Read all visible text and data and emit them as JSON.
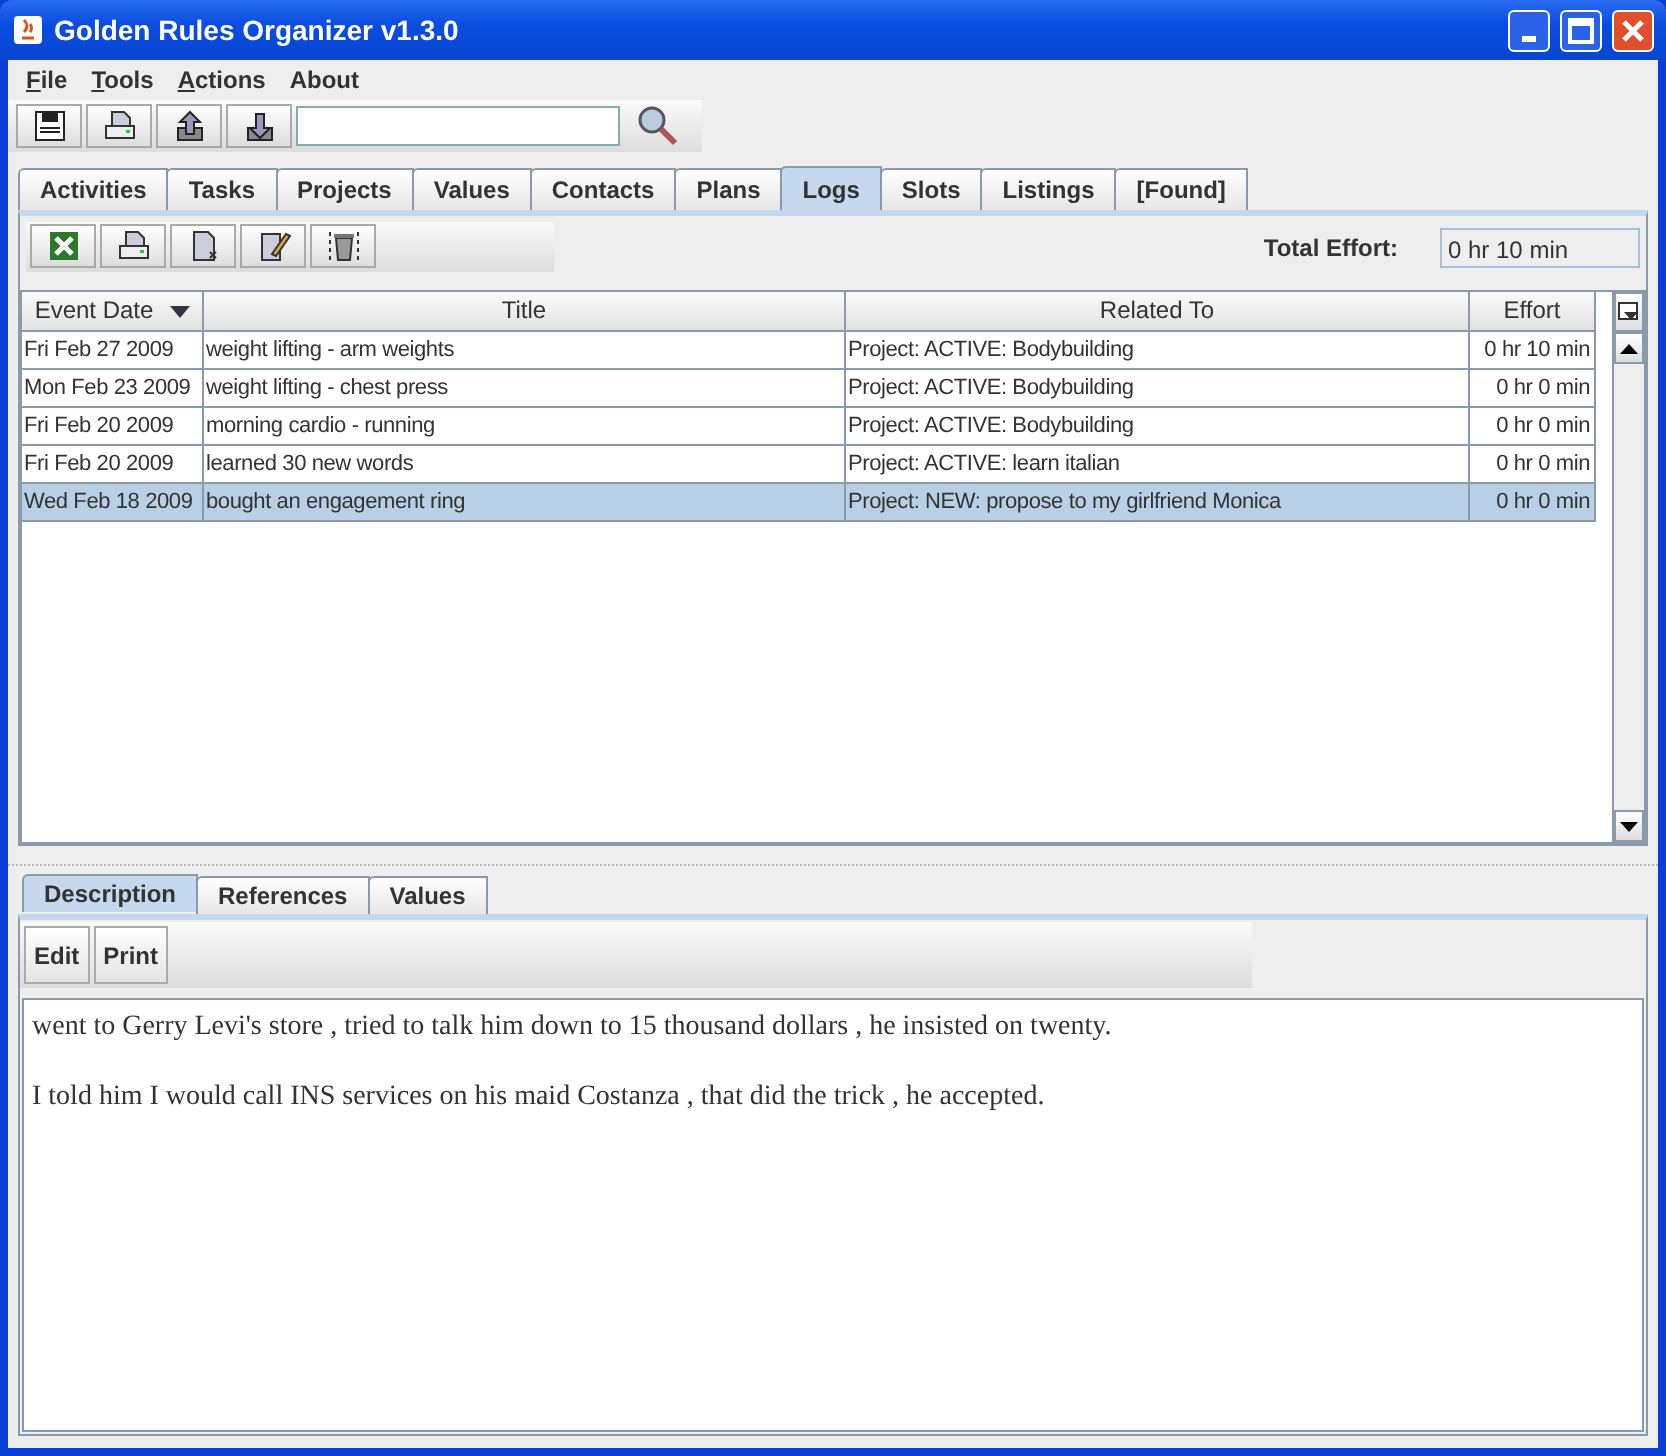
{
  "window": {
    "title": "Golden Rules Organizer v1.3.0"
  },
  "menu": [
    {
      "label": "File",
      "mnemonic": true
    },
    {
      "label": "Tools",
      "mnemonic": true
    },
    {
      "label": "Actions",
      "mnemonic": true
    },
    {
      "label": "About",
      "mnemonic": false
    }
  ],
  "toolbar": {
    "buttons": [
      {
        "kind": "save"
      },
      {
        "kind": "print"
      },
      {
        "kind": "upload"
      },
      {
        "kind": "download"
      }
    ]
  },
  "tabs": [
    {
      "label": "Activities",
      "selected": false
    },
    {
      "label": "Tasks",
      "selected": false
    },
    {
      "label": "Projects",
      "selected": false
    },
    {
      "label": "Values",
      "selected": false
    },
    {
      "label": "Contacts",
      "selected": false
    },
    {
      "label": "Plans",
      "selected": false
    },
    {
      "label": "Logs",
      "selected": true
    },
    {
      "label": "Slots",
      "selected": false
    },
    {
      "label": "Listings",
      "selected": false
    },
    {
      "label": "[Found]",
      "selected": false
    }
  ],
  "logs_toolbar": {
    "buttons": [
      {
        "kind": "excel"
      },
      {
        "kind": "print"
      },
      {
        "kind": "new"
      },
      {
        "kind": "edit"
      },
      {
        "kind": "delete"
      }
    ],
    "total_effort_label": "Total Effort:",
    "total_effort": "0 hr 10 min"
  },
  "table": {
    "columns": [
      {
        "label": "Event Date",
        "sorted": true
      },
      {
        "label": "Title",
        "sorted": false
      },
      {
        "label": "Related To",
        "sorted": false
      },
      {
        "label": "Effort",
        "sorted": false
      }
    ],
    "rows": [
      {
        "cells": [
          "Fri Feb 27 2009",
          "weight lifting - arm weights",
          "Project: ACTIVE: Bodybuilding",
          "0 hr 10 min"
        ],
        "selected": false
      },
      {
        "cells": [
          "Mon Feb 23 2009",
          "weight lifting - chest press",
          "Project: ACTIVE: Bodybuilding",
          "0 hr 0 min"
        ],
        "selected": false
      },
      {
        "cells": [
          "Fri Feb 20 2009",
          "morning cardio - running",
          "Project: ACTIVE: Bodybuilding",
          "0 hr 0 min"
        ],
        "selected": false
      },
      {
        "cells": [
          "Fri Feb 20 2009",
          "learned 30 new words",
          "Project: ACTIVE: learn italian",
          "0 hr 0 min"
        ],
        "selected": false
      },
      {
        "cells": [
          "Wed Feb 18 2009",
          "bought an engagement ring",
          "Project: NEW: propose to my girlfriend  Monica",
          "0 hr 0 min"
        ],
        "selected": true
      }
    ]
  },
  "detail_tabs": [
    {
      "label": "Description",
      "selected": true
    },
    {
      "label": "References",
      "selected": false
    },
    {
      "label": "Values",
      "selected": false
    }
  ],
  "detail_buttons": [
    "Edit",
    "Print"
  ],
  "description": [
    "went to Gerry Levi's store , tried to talk him down to 15 thousand dollars , he insisted on twenty.",
    "I told him I would call INS services on his maid Costanza , that did the trick , he accepted."
  ]
}
